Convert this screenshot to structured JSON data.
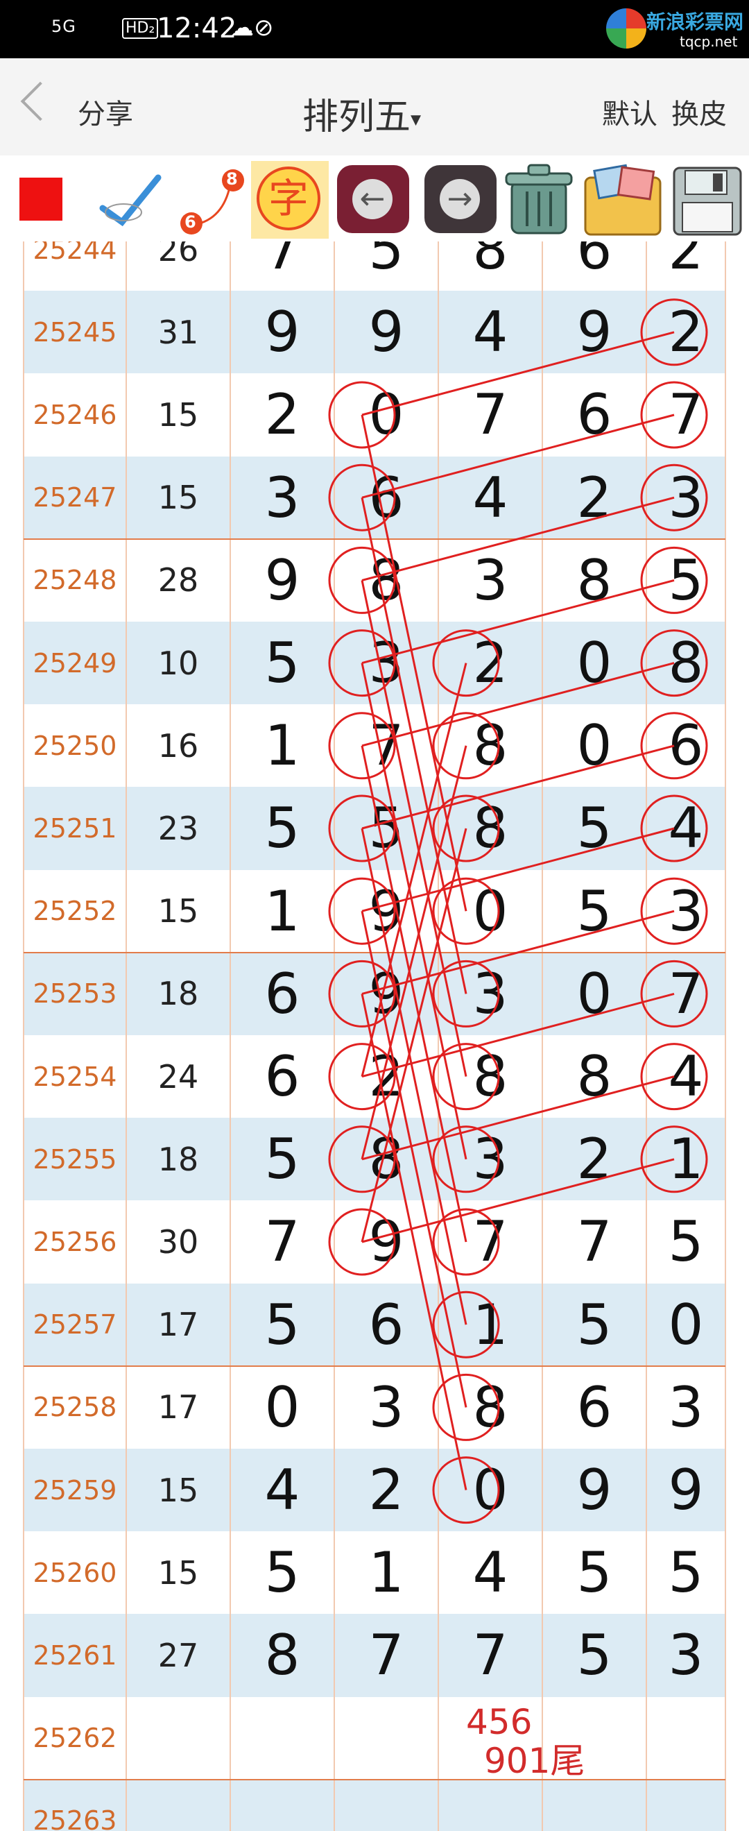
{
  "status_bar": {
    "signal": "5G",
    "hd": "HD₂",
    "time": "12:42",
    "status_icons": "☁⊘",
    "watermark_title": "新浪彩票网",
    "watermark_url": "tqcp.net"
  },
  "nav": {
    "share": "分享",
    "title": "排列五",
    "title_arrow": "▾",
    "default": "默认",
    "skin": "换皮"
  },
  "toolbar": {
    "badge_top": "8",
    "badge_bottom": "6",
    "zi": "字",
    "prev_arrow": "←",
    "next_arrow": "→"
  },
  "colors": {
    "issue": "#d26a2a",
    "row_blue": "#dcebf4",
    "circle": "#e02020",
    "header_bg": "#f4f4f4"
  },
  "rows": [
    {
      "issue": "25244",
      "sum": "26",
      "digits": [
        "7",
        "5",
        "8",
        "6",
        "2"
      ]
    },
    {
      "issue": "25245",
      "sum": "31",
      "digits": [
        "9",
        "9",
        "4",
        "9",
        "2"
      ]
    },
    {
      "issue": "25246",
      "sum": "15",
      "digits": [
        "2",
        "0",
        "7",
        "6",
        "7"
      ]
    },
    {
      "issue": "25247",
      "sum": "15",
      "digits": [
        "3",
        "6",
        "4",
        "2",
        "3"
      ]
    },
    {
      "issue": "25248",
      "sum": "28",
      "digits": [
        "9",
        "8",
        "3",
        "8",
        "5"
      ]
    },
    {
      "issue": "25249",
      "sum": "10",
      "digits": [
        "5",
        "3",
        "2",
        "0",
        "8"
      ]
    },
    {
      "issue": "25250",
      "sum": "16",
      "digits": [
        "1",
        "7",
        "8",
        "0",
        "6"
      ]
    },
    {
      "issue": "25251",
      "sum": "23",
      "digits": [
        "5",
        "5",
        "8",
        "5",
        "4"
      ]
    },
    {
      "issue": "25252",
      "sum": "15",
      "digits": [
        "1",
        "9",
        "0",
        "5",
        "3"
      ]
    },
    {
      "issue": "25253",
      "sum": "18",
      "digits": [
        "6",
        "9",
        "3",
        "0",
        "7"
      ]
    },
    {
      "issue": "25254",
      "sum": "24",
      "digits": [
        "6",
        "2",
        "8",
        "8",
        "4"
      ]
    },
    {
      "issue": "25255",
      "sum": "18",
      "digits": [
        "5",
        "8",
        "3",
        "2",
        "1"
      ]
    },
    {
      "issue": "25256",
      "sum": "30",
      "digits": [
        "7",
        "9",
        "7",
        "7",
        "5"
      ]
    },
    {
      "issue": "25257",
      "sum": "17",
      "digits": [
        "5",
        "6",
        "1",
        "5",
        "0"
      ]
    },
    {
      "issue": "25258",
      "sum": "17",
      "digits": [
        "0",
        "3",
        "8",
        "6",
        "3"
      ]
    },
    {
      "issue": "25259",
      "sum": "15",
      "digits": [
        "4",
        "2",
        "0",
        "9",
        "9"
      ]
    },
    {
      "issue": "25260",
      "sum": "15",
      "digits": [
        "5",
        "1",
        "4",
        "5",
        "5"
      ]
    },
    {
      "issue": "25261",
      "sum": "27",
      "digits": [
        "8",
        "7",
        "7",
        "5",
        "3"
      ]
    },
    {
      "issue": "25262",
      "sum": "",
      "digits": [
        "",
        "",
        "",
        "",
        ""
      ]
    },
    {
      "issue": "25263",
      "sum": "",
      "digits": [
        "",
        "",
        "",
        "",
        ""
      ]
    }
  ],
  "note": {
    "line1": "456",
    "line2": "901尾"
  },
  "circled_cells": [
    [
      1,
      4
    ],
    [
      2,
      1
    ],
    [
      2,
      4
    ],
    [
      3,
      1
    ],
    [
      3,
      4
    ],
    [
      4,
      1
    ],
    [
      4,
      4
    ],
    [
      5,
      1
    ],
    [
      5,
      2
    ],
    [
      5,
      4
    ],
    [
      6,
      1
    ],
    [
      6,
      2
    ],
    [
      6,
      4
    ],
    [
      7,
      1
    ],
    [
      7,
      2
    ],
    [
      7,
      4
    ],
    [
      8,
      1
    ],
    [
      8,
      2
    ],
    [
      8,
      4
    ],
    [
      9,
      1
    ],
    [
      9,
      2
    ],
    [
      9,
      4
    ],
    [
      10,
      1
    ],
    [
      10,
      2
    ],
    [
      10,
      4
    ],
    [
      11,
      1
    ],
    [
      11,
      2
    ],
    [
      11,
      4
    ],
    [
      12,
      1
    ],
    [
      12,
      2
    ],
    [
      13,
      2
    ],
    [
      14,
      2
    ],
    [
      15,
      2
    ]
  ],
  "connections": [
    [
      [
        1,
        4
      ],
      [
        2,
        1
      ]
    ],
    [
      [
        2,
        4
      ],
      [
        3,
        1
      ]
    ],
    [
      [
        3,
        4
      ],
      [
        4,
        1
      ]
    ],
    [
      [
        4,
        4
      ],
      [
        5,
        1
      ]
    ],
    [
      [
        5,
        4
      ],
      [
        6,
        1
      ]
    ],
    [
      [
        6,
        4
      ],
      [
        7,
        1
      ]
    ],
    [
      [
        7,
        4
      ],
      [
        8,
        1
      ]
    ],
    [
      [
        8,
        4
      ],
      [
        9,
        1
      ]
    ],
    [
      [
        9,
        4
      ],
      [
        10,
        1
      ]
    ],
    [
      [
        10,
        4
      ],
      [
        11,
        1
      ]
    ],
    [
      [
        11,
        4
      ],
      [
        12,
        1
      ]
    ],
    [
      [
        2,
        1
      ],
      [
        8,
        2
      ]
    ],
    [
      [
        3,
        1
      ],
      [
        9,
        2
      ]
    ],
    [
      [
        4,
        1
      ],
      [
        10,
        2
      ]
    ],
    [
      [
        5,
        1
      ],
      [
        11,
        2
      ]
    ],
    [
      [
        6,
        1
      ],
      [
        12,
        2
      ]
    ],
    [
      [
        7,
        1
      ],
      [
        13,
        2
      ]
    ],
    [
      [
        8,
        1
      ],
      [
        14,
        2
      ]
    ],
    [
      [
        9,
        1
      ],
      [
        15,
        2
      ]
    ],
    [
      [
        10,
        1
      ],
      [
        5,
        2
      ]
    ],
    [
      [
        11,
        1
      ],
      [
        6,
        2
      ]
    ],
    [
      [
        12,
        1
      ],
      [
        7,
        2
      ]
    ]
  ]
}
